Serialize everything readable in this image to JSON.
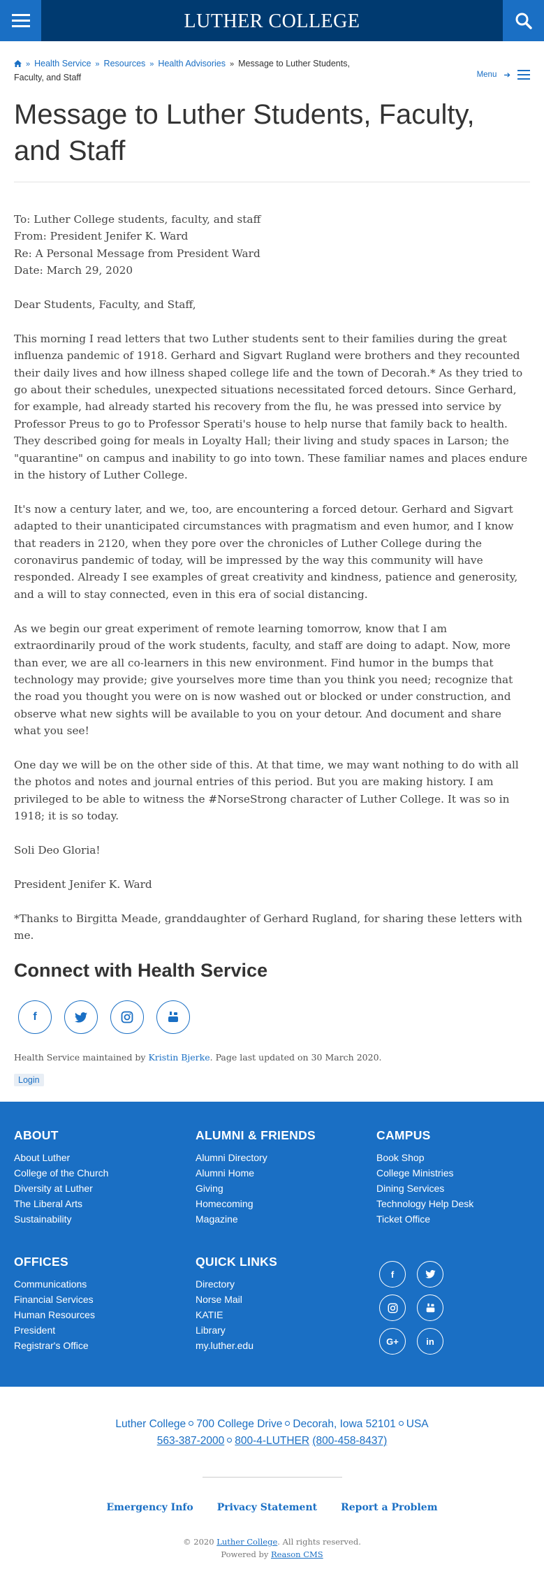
{
  "header": {
    "logo": "LUTHER COLLEGE"
  },
  "breadcrumb": {
    "items": [
      "Health Service",
      "Resources",
      "Health Advisories"
    ],
    "current": "Message to Luther Students, Faculty, and Staff",
    "menu_label": "Menu"
  },
  "page": {
    "title": "Message to Luther Students, Faculty, and Staff"
  },
  "article": {
    "to": "To: Luther College students, faculty, and staff",
    "from": "From: President Jenifer K. Ward",
    "re": "Re: A Personal Message from President Ward",
    "date": "Date: March 29, 2020",
    "greeting": "Dear Students, Faculty, and Staff,",
    "p1": "This morning I read letters that two Luther students sent to their families during the great influenza pandemic of 1918. Gerhard and Sigvart Rugland were brothers and they recounted their daily lives and how illness shaped college life and the town of Decorah.* As they tried to go about their schedules, unexpected situations necessitated forced detours. Since Gerhard, for example, had already started his recovery from the flu, he was pressed into service by Professor Preus to go to Professor Sperati's house to help nurse that family back to health. They described going for meals in Loyalty Hall; their living and study spaces in Larson; the \"quarantine\" on campus and inability to go into town. These familiar names and places endure in the history of Luther College.",
    "p2": "It's now a century later, and we, too, are encountering a forced detour. Gerhard and Sigvart adapted to their unanticipated circumstances with pragmatism and even humor, and I know that readers in 2120, when they pore over the chronicles of Luther College during the coronavirus pandemic of today, will be impressed by the way this community will have responded. Already I see examples of great creativity and kindness, patience and generosity, and a will to stay connected, even in this era of social distancing.",
    "p3": "As we begin our great experiment of remote learning tomorrow, know that I am extraordinarily proud of the work students, faculty, and staff are doing to adapt. Now, more than ever, we are all co-learners in this new environment. Find humor in the bumps that technology may provide; give yourselves more time than you think you need; recognize that the road you thought you were on is now washed out or blocked or under construction, and observe what new sights will be available to you on your detour. And document and share what you see!",
    "p4": "One day we will be on the other side of this. At that time, we may want nothing to do with all the photos and notes and journal entries of this period. But you are making history. I am privileged to be able to witness the #NorseStrong character of Luther College. It was so in 1918; it is so today.",
    "closing": "Soli Deo Gloria!",
    "signature": "President Jenifer K. Ward",
    "footnote": "*Thanks to Birgitta Meade, granddaughter of Gerhard Rugland, for sharing these letters with me."
  },
  "connect": {
    "title": "Connect with Health Service",
    "maintained_prefix": "Health Service maintained by ",
    "maintainer": "Kristin Bjerke",
    "maintained_suffix": ". Page last updated on 30 March 2020.",
    "login": "Login"
  },
  "footer": {
    "about": {
      "title": "ABOUT",
      "items": [
        "About Luther",
        "College of the Church",
        "Diversity at Luther",
        "The Liberal Arts",
        "Sustainability"
      ]
    },
    "alumni": {
      "title": "ALUMNI & FRIENDS",
      "items": [
        "Alumni Directory",
        "Alumni Home",
        "Giving",
        "Homecoming",
        "Magazine"
      ]
    },
    "campus": {
      "title": "CAMPUS",
      "items": [
        "Book Shop",
        "College Ministries",
        "Dining Services",
        "Technology Help Desk",
        "Ticket Office"
      ]
    },
    "offices": {
      "title": "OFFICES",
      "items": [
        "Communications",
        "Financial Services",
        "Human Resources",
        "President",
        "Registrar's Office"
      ]
    },
    "quick": {
      "title": "QUICK LINKS",
      "items": [
        "Directory",
        "Norse Mail",
        "KATIE",
        "Library",
        "my.luther.edu"
      ]
    }
  },
  "address": {
    "name": "Luther College",
    "street": "700 College Drive",
    "city": "Decorah, Iowa 52101",
    "country": "USA",
    "phone1": "563-387-2000",
    "phone2": "800-4-LUTHER",
    "phone3": "(800-458-8437)"
  },
  "bottom_links": [
    "Emergency Info",
    "Privacy Statement",
    "Report a Problem"
  ],
  "copyright": {
    "prefix": "© 2020 ",
    "org": "Luther College",
    "suffix": ". All rights reserved.",
    "powered_prefix": "Powered by ",
    "cms": "Reason CMS"
  },
  "colors": {
    "header": "#003a70",
    "accent": "#1a6fc4"
  }
}
